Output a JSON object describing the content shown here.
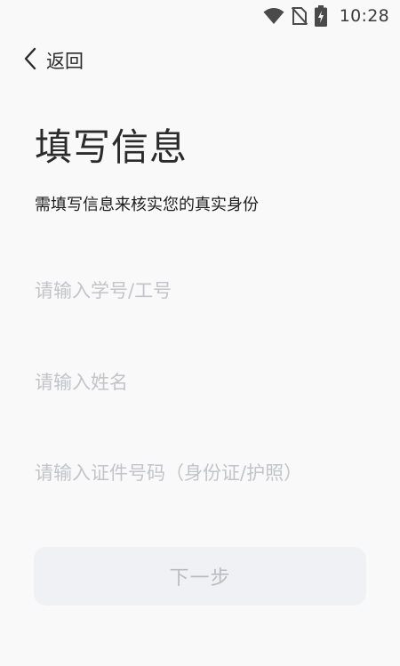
{
  "status_bar": {
    "time": "10:28",
    "icons": [
      "wifi-icon",
      "no-sim-icon",
      "battery-charging-icon"
    ]
  },
  "nav": {
    "back_label": "返回",
    "back_icon": "chevron-left-icon"
  },
  "header": {
    "title": "填写信息",
    "subtitle": "需填写信息来核实您的真实身份"
  },
  "form": {
    "student_id": {
      "placeholder": "请输入学号/工号",
      "value": ""
    },
    "name": {
      "placeholder": "请输入姓名",
      "value": ""
    },
    "id_document": {
      "placeholder": "请输入证件号码（身份证/护照）",
      "value": ""
    }
  },
  "actions": {
    "next_label": "下一步"
  },
  "colors": {
    "background": "#f9f9fa",
    "placeholder": "#c2c4c8",
    "button_bg": "#f0f1f4",
    "button_text": "#b9bcc2"
  }
}
